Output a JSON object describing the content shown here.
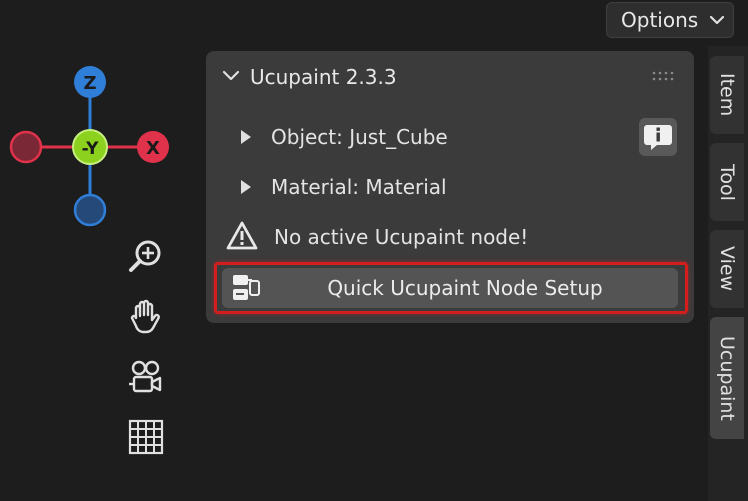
{
  "header": {
    "options_label": "Options"
  },
  "gizmo": {
    "z": "Z",
    "y": "-Y",
    "x": "X"
  },
  "sidebar": {
    "tabs": [
      {
        "label": "Item"
      },
      {
        "label": "Tool"
      },
      {
        "label": "View"
      },
      {
        "label": "Ucupaint"
      }
    ]
  },
  "panel": {
    "title": "Ucupaint 2.3.3",
    "object_label": "Object: Just_Cube",
    "material_label": "Material: Material",
    "warning": "No active Ucupaint node!",
    "setup_button": "Quick Ucupaint Node Setup"
  },
  "colors": {
    "x_axis": "#e0324a",
    "y_axis": "#8bd11e",
    "z_axis": "#2f7fd8",
    "highlight": "#d21e1e"
  }
}
